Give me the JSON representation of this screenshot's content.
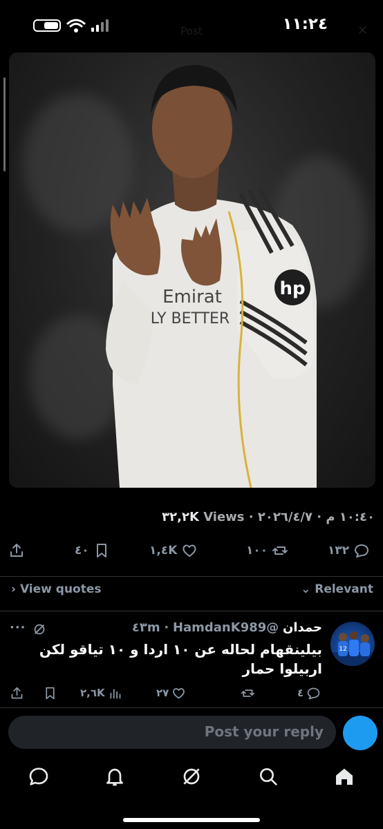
{
  "status_bar": {
    "time": "١١:٢٤"
  },
  "header": {
    "title": "Post"
  },
  "post": {
    "timestamp": "١٠:٤٠ م · ٢٠٢٦/٤/٧",
    "views_count": "٣٢,٢K",
    "views_label": "Views",
    "stats": {
      "replies": "١٣٢",
      "reposts": "١٠٠",
      "likes": "١,٤K",
      "bookmarks": "٤٠"
    }
  },
  "filters": {
    "view_quotes": "View quotes",
    "sort": "Relevant"
  },
  "reply": {
    "name": "حمدان",
    "handle": "@HamdanK989",
    "time": "٤٣m",
    "text": "بيلينقهام لحاله عن ١٠ اردا و ١٠ تياقو لكن اربيلوا حمار",
    "stats": {
      "replies": "٤",
      "likes": "٢٧",
      "views": "٢,٦K"
    }
  },
  "composer": {
    "placeholder": "Post your reply"
  },
  "colors": {
    "accent": "#1d9bf0",
    "background": "#000000",
    "muted": "#8b98a5"
  }
}
